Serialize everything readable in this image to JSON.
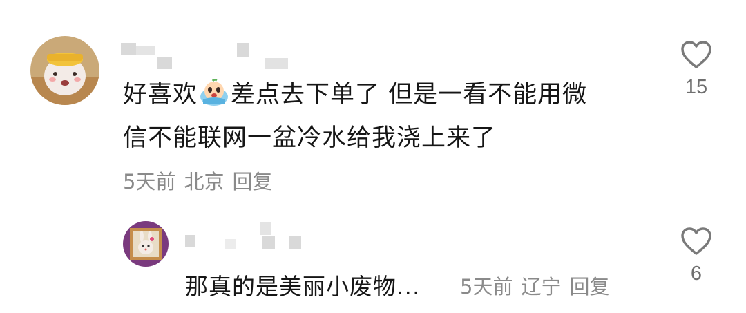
{
  "comments": [
    {
      "text_before_emoji": "好喜欢",
      "emoji": "crying-face-emoji",
      "text_after_emoji": "差点去下单了 但是一看不能用微",
      "text_line2": "信不能联网一盆冷水给我浇上来了",
      "time": "5天前",
      "location": "北京",
      "reply_label": "回复",
      "likes": "15",
      "username_blurred": true
    }
  ],
  "replies": [
    {
      "text": "那真的是美丽小废物...",
      "time": "5天前",
      "location": "辽宁",
      "reply_label": "回复",
      "likes": "6",
      "username_blurred": true
    }
  ],
  "colors": {
    "text": "#161616",
    "meta": "#8a8a8a",
    "heart": "#7a7a7a",
    "blur": "#d9d9d9"
  }
}
